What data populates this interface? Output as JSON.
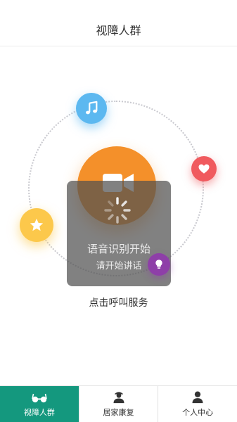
{
  "header": {
    "title": "视障人群"
  },
  "main": {
    "icons": [
      "music-note-icon",
      "heart-icon",
      "star-icon",
      "lightbulb-icon",
      "video-camera-icon"
    ],
    "overlay": {
      "title": "语音识别开始",
      "subtitle": "请开始讲话"
    },
    "caption": "点击呼叫服务"
  },
  "tabbar": {
    "active_index": 0,
    "tabs": [
      {
        "label": "视障人群",
        "icon": "glasses-icon"
      },
      {
        "label": "居家康复",
        "icon": "caregiver-icon"
      },
      {
        "label": "个人中心",
        "icon": "user-icon"
      }
    ]
  },
  "colors": {
    "primary": "#14987e",
    "call_orange": "#f4902a",
    "music_blue": "#5cb8f0",
    "heart_red": "#f05a5e",
    "star_yellow": "#fcc84b",
    "idea_purple": "#8e3fa8"
  }
}
